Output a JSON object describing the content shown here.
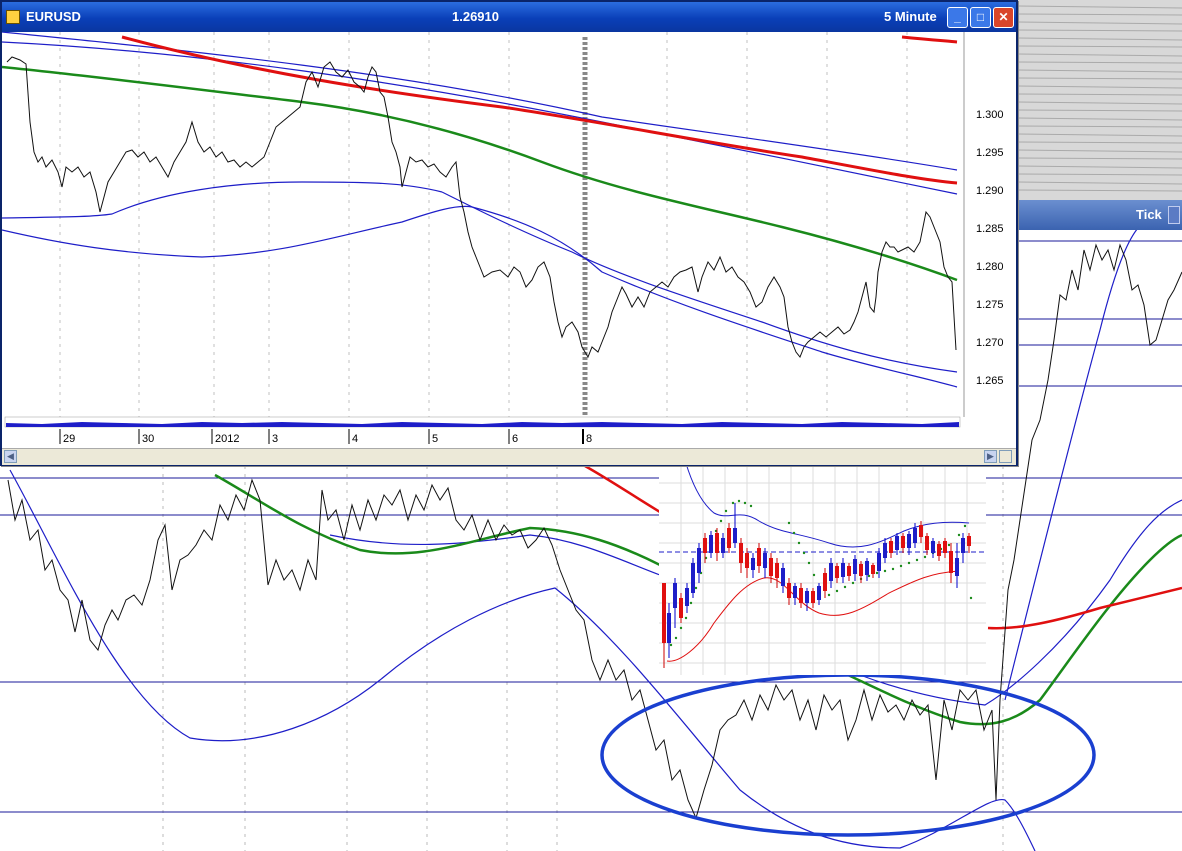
{
  "window": {
    "symbol": "EURUSD",
    "price": "1.26910",
    "timeframe": "5 Minute",
    "minimize_glyph": "_",
    "maximize_glyph": "□",
    "close_glyph": "✕"
  },
  "price_axis": {
    "labels": [
      "1.300",
      "1.295",
      "1.290",
      "1.285",
      "1.280",
      "1.275",
      "1.270",
      "1.265"
    ]
  },
  "date_axis": {
    "labels": [
      "29",
      "30",
      "2012",
      "3",
      "4",
      "5",
      "6",
      "8"
    ]
  },
  "tick_panel": {
    "label": "Tick"
  },
  "scroll": {
    "left_arrow": "◀",
    "right_arrow": "▶"
  },
  "colors": {
    "title_bar": "#0a3fb8",
    "red_ma": "#e01010",
    "green_ma": "#1a8a1a",
    "bands": "#1e1ec8",
    "ellipse": "#1a3fd0"
  }
}
